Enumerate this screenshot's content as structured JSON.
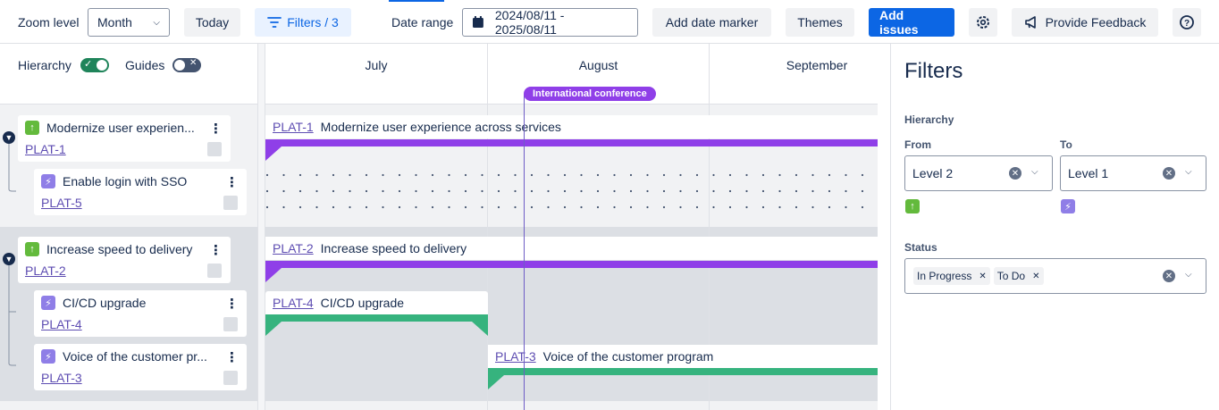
{
  "toolbar": {
    "zoom_label": "Zoom level",
    "zoom_value": "Month",
    "today": "Today",
    "filters": "Filters / 3",
    "date_range_label": "Date range",
    "date_range_value": "2024/08/11 - 2025/08/11",
    "add_date_marker": "Add date marker",
    "themes": "Themes",
    "add_issues": "Add issues",
    "provide_feedback": "Provide Feedback"
  },
  "left": {
    "hierarchy_label": "Hierarchy",
    "hierarchy_on": true,
    "guides_label": "Guides",
    "guides_on": false
  },
  "issues": [
    {
      "key": "PLAT-1",
      "title": "Modernize user experien...",
      "bar_title": "Modernize user experience across services",
      "type": "story-icon",
      "level": 0
    },
    {
      "key": "PLAT-5",
      "title": "Enable login with SSO",
      "type": "subtask-icon",
      "level": 1
    },
    {
      "key": "PLAT-2",
      "title": "Increase speed to delivery",
      "bar_title": "Increase speed to delivery",
      "type": "story-icon",
      "level": 0
    },
    {
      "key": "PLAT-4",
      "title": "CI/CD upgrade",
      "bar_title": "CI/CD upgrade",
      "type": "subtask-icon",
      "level": 1
    },
    {
      "key": "PLAT-3",
      "title": "Voice of the customer pr...",
      "bar_title": "Voice of the customer program",
      "type": "subtask-icon",
      "level": 1
    }
  ],
  "timeline": {
    "months": [
      "July",
      "August",
      "September"
    ],
    "marker": "International conference"
  },
  "filters_panel": {
    "title": "Filters",
    "hierarchy_label": "Hierarchy",
    "from_label": "From",
    "from_value": "Level 2",
    "to_label": "To",
    "to_value": "Level 1",
    "status_label": "Status",
    "status_tags": [
      "In Progress",
      "To Do"
    ]
  },
  "colors": {
    "accent": "#0c66e4",
    "bar_purple": "#8f3fe8",
    "bar_green": "#36b37e",
    "story": "#63ba3c",
    "subtask": "#8f7ee7"
  }
}
